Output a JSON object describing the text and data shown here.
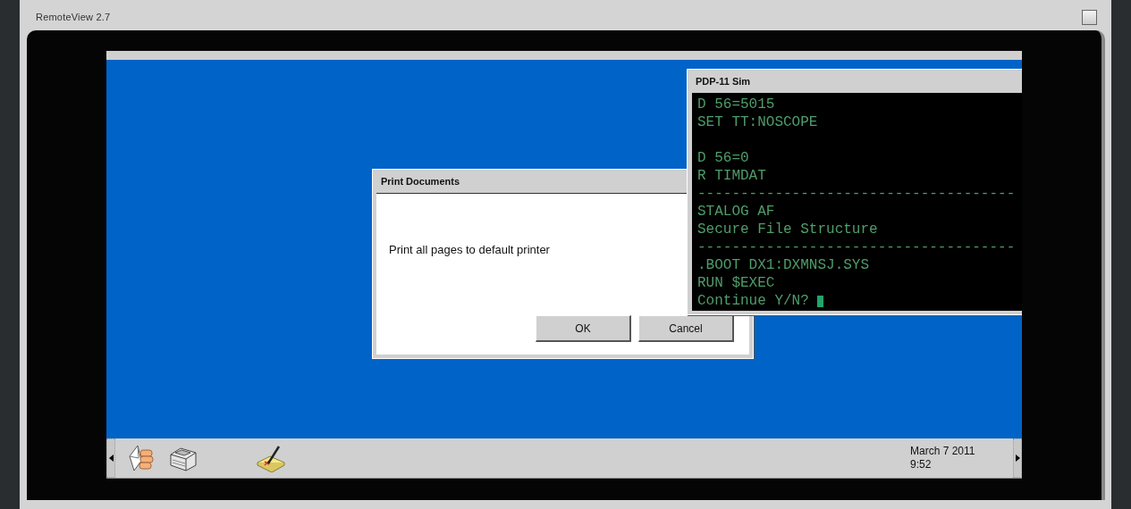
{
  "app": {
    "title": "RemoteView 2.7",
    "maximize_checked": false
  },
  "dialog": {
    "title": "Print Documents",
    "message": "Print all pages to default printer",
    "buttons": [
      "OK",
      "Cancel"
    ]
  },
  "terminal": {
    "title": "PDP-11 Sim",
    "lines": [
      {
        "kind": "text",
        "text": "D 56=5015"
      },
      {
        "kind": "text",
        "text": "SET TT:NOSCOPE"
      },
      {
        "kind": "blank"
      },
      {
        "kind": "text",
        "text": "D 56=0"
      },
      {
        "kind": "text",
        "text": "R TIMDAT"
      },
      {
        "kind": "rule",
        "text": "-------------------------------------"
      },
      {
        "kind": "text",
        "text": "STALOG AF"
      },
      {
        "kind": "text",
        "text": "Secure File Structure"
      },
      {
        "kind": "rule",
        "text": "-------------------------------------"
      },
      {
        "kind": "text",
        "text": ".BOOT DX1:DXMNSJ.SYS"
      },
      {
        "kind": "text",
        "text": "RUN $EXEC"
      },
      {
        "kind": "prompt",
        "text": "Continue Y/N?"
      }
    ]
  },
  "taskbar": {
    "icons": [
      {
        "kind": "mail"
      },
      {
        "kind": "printer"
      },
      {
        "kind": "notepad"
      }
    ],
    "date": "March 7 2011",
    "time": "9:52"
  }
}
